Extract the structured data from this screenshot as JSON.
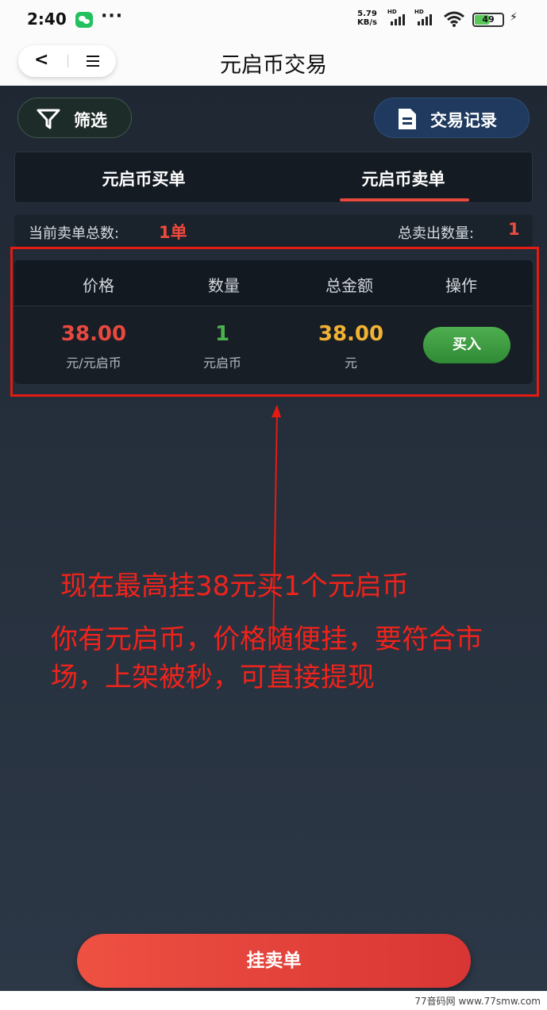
{
  "status_bar": {
    "time": "2:40",
    "dots": "···",
    "net_speed_value": "5.79",
    "net_speed_unit": "KB/s",
    "hd_1": "HD",
    "hd_2": "HD",
    "battery": "49",
    "charging_icon": "bolt-icon",
    "wechat_icon": "wechat-icon",
    "wifi_icon": "wifi-icon"
  },
  "header": {
    "title": "元启币交易",
    "back_icon": "back-arrow-icon",
    "menu_icon": "menu-icon"
  },
  "toolbar": {
    "filter_label": "筛选",
    "filter_icon": "filter-icon",
    "record_label": "交易记录",
    "record_icon": "document-icon"
  },
  "tabs": [
    {
      "label": "元启币买单",
      "active": false
    },
    {
      "label": "元启币卖单",
      "active": true
    }
  ],
  "summary": {
    "total_orders_label": "当前卖单总数:",
    "total_orders_value": "1单",
    "total_sold_label": "总卖出数量:",
    "total_sold_value": "1"
  },
  "table": {
    "headers": [
      "价格",
      "数量",
      "总金额",
      "操作"
    ],
    "rows": [
      {
        "price": "38.00",
        "price_unit": "元/元启币",
        "quantity": "1",
        "quantity_unit": "元启币",
        "total": "38.00",
        "total_unit": "元",
        "action": "买入"
      }
    ]
  },
  "annotations": {
    "line1": "现在最高挂38元买1个元启币",
    "line2": "你有元启币，价格随便挂，要符合市场，上架被秒，可直接提现"
  },
  "bottom_button": "挂卖单",
  "watermark": "77音码网 www.77smw.com",
  "colors": {
    "accent_red": "#ef4a3e",
    "price_red": "#e8493f",
    "quantity_green": "#4caf50",
    "total_yellow": "#f2b233",
    "buy_green": "#3d9b40",
    "annotation_red": "#f0231b",
    "background_dark": "#232d3a"
  }
}
